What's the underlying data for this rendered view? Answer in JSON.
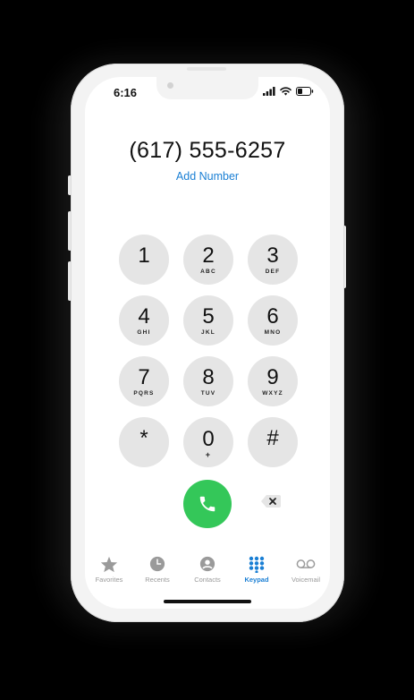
{
  "status_bar": {
    "time": "6:16",
    "icons": [
      "signal-icon",
      "wifi-icon",
      "battery-icon"
    ]
  },
  "dialer": {
    "number": "(617) 555-6257",
    "add_number_label": "Add Number"
  },
  "keypad": {
    "keys": [
      {
        "digit": "1",
        "letters": ""
      },
      {
        "digit": "2",
        "letters": "ABC"
      },
      {
        "digit": "3",
        "letters": "DEF"
      },
      {
        "digit": "4",
        "letters": "GHI"
      },
      {
        "digit": "5",
        "letters": "JKL"
      },
      {
        "digit": "6",
        "letters": "MNO"
      },
      {
        "digit": "7",
        "letters": "PQRS"
      },
      {
        "digit": "8",
        "letters": "TUV"
      },
      {
        "digit": "9",
        "letters": "WXYZ"
      },
      {
        "digit": "*",
        "letters": ""
      },
      {
        "digit": "0",
        "letters": "+"
      },
      {
        "digit": "#",
        "letters": ""
      }
    ]
  },
  "actions": {
    "call_icon": "phone-icon",
    "backspace_icon": "backspace-icon"
  },
  "tab_bar": {
    "active": "Keypad",
    "items": [
      {
        "label": "Favorites",
        "icon": "star-icon"
      },
      {
        "label": "Recents",
        "icon": "clock-icon"
      },
      {
        "label": "Contacts",
        "icon": "person-icon"
      },
      {
        "label": "Keypad",
        "icon": "keypad-grid-icon"
      },
      {
        "label": "Voicemail",
        "icon": "voicemail-icon"
      }
    ]
  },
  "colors": {
    "accent": "#1a7fd4",
    "call_green": "#34c759",
    "key_gray": "#e5e5e5",
    "inactive_tab": "#9a9a9a"
  }
}
